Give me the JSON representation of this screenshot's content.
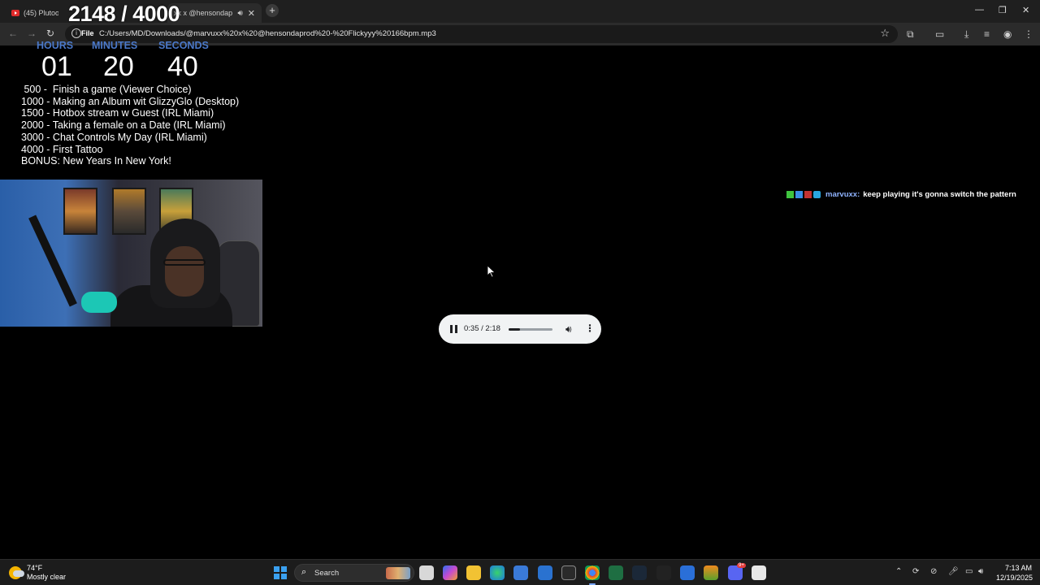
{
  "browser": {
    "tabs": [
      {
        "title": "(45) Plutooo - Y",
        "active": false
      },
      {
        "title": "xx x @hensondap",
        "active": true
      }
    ],
    "new_tab": "+",
    "url": "C:/Users/MD/Downloads/@marvuxx%20x%20@hensondaprod%20-%20Flickyyy%20166bpm.mp3",
    "scheme_label": "File"
  },
  "overlay": {
    "counter": "2148 / 4000",
    "timer": {
      "labels": [
        "HOURS",
        "MINUTES",
        "SECONDS"
      ],
      "values": [
        "01",
        "20",
        "40"
      ]
    },
    "goals": [
      " 500 -  Finish a game (Viewer Choice)",
      "1000 - Making an Album wit GlizzyGlo (Desktop)",
      "1500 - Hotbox stream w Guest (IRL Miami)",
      "2000 - Taking a female on a Date (IRL Miami)",
      "3000 - Chat Controls My Day (IRL Miami)",
      "4000 - First Tattoo",
      "BONUS: New Years In New York!"
    ],
    "chat": {
      "user": "marvuxx:",
      "message": "keep playing it's gonna switch the pattern"
    }
  },
  "player": {
    "time": "0:35 / 2:18",
    "progress": 0.254
  },
  "taskbar": {
    "weather": {
      "temp": "74°F",
      "desc": "Mostly clear"
    },
    "search_label": "Search",
    "clock": {
      "time": "7:13 AM",
      "date": "12/19/2025"
    },
    "discord_badge": "9+"
  },
  "colors": {
    "timer_label": "#4a78c8",
    "chat_user": "#8fb3ff",
    "player_bg": "#f1f3f4"
  }
}
